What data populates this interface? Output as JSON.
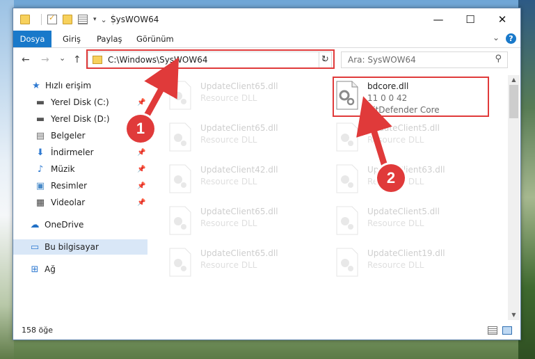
{
  "window": {
    "title": "SysWOW64",
    "minimize_glyph": "—",
    "maximize_glyph": "☐",
    "close_glyph": "✕"
  },
  "ribbon": {
    "tabs": [
      "Dosya",
      "Giriş",
      "Paylaş",
      "Görünüm"
    ],
    "help": "?"
  },
  "nav": {
    "back": "←",
    "forward": "→",
    "recent": "⌄",
    "up": "↑",
    "address": "C:\\Windows\\SysWOW64",
    "search_placeholder": "Ara: SysWOW64"
  },
  "sidebar": {
    "items": [
      {
        "label": "Hızlı erişim",
        "icon": "star-icon"
      },
      {
        "label": "Yerel Disk (C:)",
        "icon": "drive-icon",
        "pinned": true
      },
      {
        "label": "Yerel Disk (D:)",
        "icon": "drive-icon"
      },
      {
        "label": "Belgeler",
        "icon": "documents-icon"
      },
      {
        "label": "İndirmeler",
        "icon": "download-icon",
        "pinned": true
      },
      {
        "label": "Müzik",
        "icon": "music-icon",
        "pinned": true
      },
      {
        "label": "Resimler",
        "icon": "pictures-icon",
        "pinned": true
      },
      {
        "label": "Videolar",
        "icon": "videos-icon",
        "pinned": true
      },
      {
        "label": "OneDrive",
        "icon": "cloud-icon"
      },
      {
        "label": "Bu bilgisayar",
        "icon": "computer-icon",
        "selected": true
      },
      {
        "label": "Ağ",
        "icon": "network-icon"
      }
    ]
  },
  "files": [
    {
      "name": "UpdateClient65.dll",
      "desc": "Resource DLL"
    },
    {
      "name": "bdcore.dll",
      "desc": "11 0 0 42",
      "desc2": "BitDefender Core",
      "highlight": true
    },
    {
      "name": "UpdateClient65.dll",
      "desc": "Resource DLL"
    },
    {
      "name": "UpdateClient5.dll",
      "desc": "Resource DLL"
    },
    {
      "name": "UpdateClient42.dll",
      "desc": "Resource DLL"
    },
    {
      "name": "UpdateClient63.dll",
      "desc": "Resource DLL"
    },
    {
      "name": "UpdateClient65.dll",
      "desc": "Resource DLL"
    },
    {
      "name": "UpdateClient5.dll",
      "desc": "Resource DLL"
    },
    {
      "name": "UpdateClient65.dll",
      "desc": "Resource DLL"
    },
    {
      "name": "UpdateClient19.dll",
      "desc": "Resource DLL"
    }
  ],
  "status": {
    "count": "158 öğe"
  },
  "callouts": [
    "1",
    "2"
  ],
  "colors": {
    "accent": "#1979ca",
    "highlight": "#e03a3a"
  }
}
